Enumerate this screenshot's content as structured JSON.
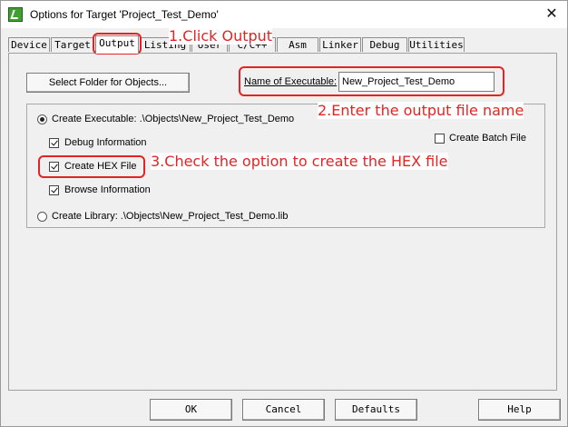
{
  "window": {
    "title": "Options for Target 'Project_Test_Demo'",
    "close_glyph": "✕"
  },
  "tabs": [
    {
      "label": "Device"
    },
    {
      "label": "Target"
    },
    {
      "label": "Output"
    },
    {
      "label": "Listing"
    },
    {
      "label": "User"
    },
    {
      "label": "C/C++"
    },
    {
      "label": "Asm"
    },
    {
      "label": "Linker"
    },
    {
      "label": "Debug"
    },
    {
      "label": "Utilities"
    }
  ],
  "output": {
    "select_folder_label": "Select Folder for Objects...",
    "name_of_executable_label": "Name of Executable:",
    "name_of_executable_value": "New_Project_Test_Demo",
    "create_executable_label": "Create Executable:  .\\Objects\\New_Project_Test_Demo",
    "debug_information_label": "Debug Information",
    "create_hex_file_label": "Create HEX File",
    "browse_information_label": "Browse Information",
    "create_batch_file_label": "Create Batch File",
    "create_library_label": "Create Library:  .\\Objects\\New_Project_Test_Demo.lib"
  },
  "annotations": {
    "step1": "1.Click Output",
    "step2": "2.Enter the output file name",
    "step3": "3.Check the option to create the HEX file",
    "color": "#e42424"
  },
  "footer": {
    "ok": "OK",
    "cancel": "Cancel",
    "defaults": "Defaults",
    "help": "Help"
  }
}
